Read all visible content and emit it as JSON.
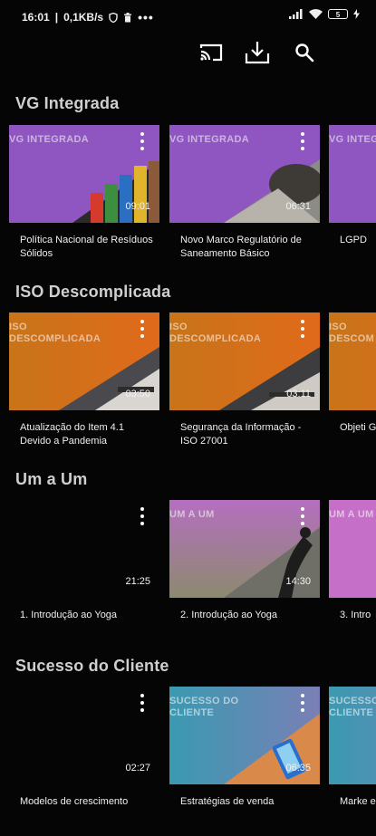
{
  "status": {
    "time": "16:01",
    "network": "0,1KB/s",
    "battery": "5"
  },
  "toolbar": {
    "cast_icon": "cast-icon",
    "download_icon": "download-icon",
    "search_icon": "search-icon"
  },
  "sections": [
    {
      "title": "VG Integrada",
      "cards": [
        {
          "thumb_label": "VG INTEGRADA",
          "duration": "09:01",
          "title": "Política Nacional de Resíduos Sólidos"
        },
        {
          "thumb_label": "VG INTEGRADA",
          "duration": "06:31",
          "title": "Novo Marco Regulatório de Saneamento Básico"
        },
        {
          "thumb_label": "VG INTEGRA",
          "duration": "",
          "title": "LGPD"
        }
      ]
    },
    {
      "title": "ISO Descomplicada",
      "cards": [
        {
          "thumb_label": "ISO\nDESCOMPLICADA",
          "duration": "03:50",
          "title": "Atualização do Item 4.1 Devido a Pandemia"
        },
        {
          "thumb_label": "ISO\nDESCOMPLICADA",
          "duration": "03:11",
          "title": "Segurança da Informação - ISO 27001"
        },
        {
          "thumb_label": "ISO\nDESCOM",
          "duration": "",
          "title": "Objeti Gestã"
        }
      ]
    },
    {
      "title": "Um a Um",
      "cards": [
        {
          "thumb_label": "",
          "duration": "21:25",
          "title": "1. Introdução ao Yoga"
        },
        {
          "thumb_label": "UM A UM",
          "duration": "14:30",
          "title": "2. Introdução ao Yoga"
        },
        {
          "thumb_label": "UM A UM",
          "duration": "",
          "title": "3. Intro"
        }
      ]
    },
    {
      "title": "Sucesso do Cliente",
      "cards": [
        {
          "thumb_label": "",
          "duration": "02:27",
          "title": "Modelos de crescimento"
        },
        {
          "thumb_label": "SUCESSO DO\nCLIENTE",
          "duration": "06:35",
          "title": "Estratégias de venda"
        },
        {
          "thumb_label": "SUCESSO\nCLIENTE",
          "duration": "",
          "title": "Marke engaj"
        }
      ]
    }
  ]
}
